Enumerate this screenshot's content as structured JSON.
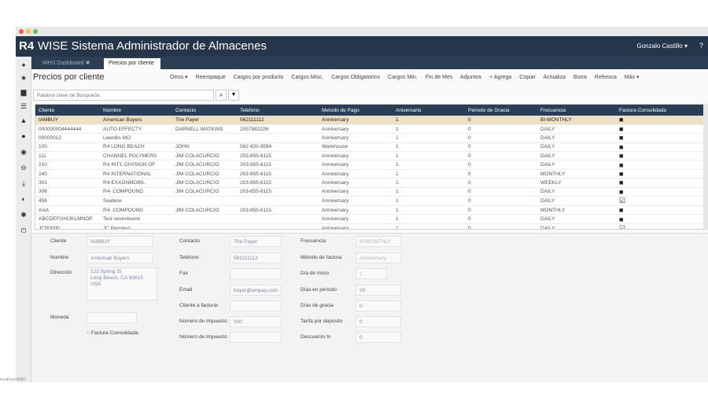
{
  "app": {
    "logo": "R4",
    "title": "WISE Sistema Administrador de Almacenes",
    "user": "Gonzalo Castillo ▾",
    "help": "?"
  },
  "tabs": [
    {
      "label": "WHS Dashboard ✖"
    },
    {
      "label": "Precios por cliente"
    }
  ],
  "page": {
    "title": "Precios por cliente"
  },
  "toolbar": {
    "items": [
      "Otros ▾",
      "Reempaque",
      "Cargos por producto",
      "Cargos Misc.",
      "Cargos Obligatorios",
      "Cargos Min.",
      "Fin de Mes",
      "Adjuntos",
      "+ Agrega",
      "Copiar",
      "Actualiza",
      "Borra",
      "Refresca",
      "Más ▾"
    ]
  },
  "search": {
    "placeholder": "Palabra clave de Busqueda"
  },
  "grid": {
    "columns": [
      "Cliente",
      "Nombre",
      "Contacto",
      "Telefono",
      "Metodo de Pago",
      "Aniversario",
      "Periodo de Gracia",
      "Frecuencia",
      "Factura Consolidada"
    ],
    "rows": [
      [
        "IAMBUY",
        "American Buyers",
        "The Payer",
        "562111112",
        "Anniversary",
        "1",
        "0",
        "BI-MONTHLY",
        "■"
      ],
      [
        "000000004444444",
        "AUTO EFFECTY",
        "DARNELL WATKINS",
        "2057882226",
        "Anniversary",
        "1",
        "0",
        "DAILY",
        "■"
      ],
      [
        "00000012",
        "Leenibs MO",
        "",
        "",
        "Anniversary",
        "1",
        "0",
        "DAILY",
        "■"
      ],
      [
        "100",
        "R4 LONG BEACH",
        "JOHN",
        "562 420-9594",
        "Warehouse",
        "1",
        "0",
        "DAILY",
        "■"
      ],
      [
        "111",
        "CHANNEL POLYMERS",
        "JIM COLACURCIO",
        "203-855-6115",
        "Anniversary",
        "1",
        "0",
        "DAILY",
        "■"
      ],
      [
        "210",
        "R4 INT'L DIVISION OF",
        "JIM COLACURCIO",
        "203-855-6115",
        "Anniversary",
        "1",
        "0",
        "DAILY",
        "■"
      ],
      [
        "240",
        "R4 INTERNATIONAL",
        "JIM COLACURCIO",
        "203-855-6115",
        "Anniversary",
        "1",
        "0",
        "MONTHLY",
        "■"
      ],
      [
        "301",
        "R4-EXXONMOBIL",
        "JIM COLACURCIO",
        "203-855-6115",
        "Anniversary",
        "1",
        "0",
        "WEEKLY",
        "■"
      ],
      [
        "306",
        "R4- COMPOUND",
        "JIM COLACURCIO",
        "203-855-6115",
        "Anniversary",
        "1",
        "0",
        "DAILY",
        "■"
      ],
      [
        "456",
        "Sealane",
        "",
        "",
        "Anniversary",
        "1",
        "0",
        "DAILY",
        "☑"
      ],
      [
        "AAA",
        "R4- COMPOUND",
        "JIM COLACURCIO",
        "203-855-6115",
        "Anniversary",
        "1",
        "0",
        "MONTHLY",
        "■"
      ],
      [
        "ABCDEFGHIJKLMNOP",
        "Test seventeenn",
        "",
        "",
        "Anniversary",
        "1",
        "0",
        "DAILY",
        "■"
      ],
      [
        "JCP0000",
        "JC Penneys",
        "",
        "",
        "Anniversary",
        "1",
        "0",
        "DAILY",
        "☑"
      ]
    ]
  },
  "detail": {
    "cliente_label": "Cliente",
    "cliente": "IAMBUY",
    "nombre_label": "Nombre",
    "nombre": "American Buyers",
    "direccion_label": "Dirección",
    "direccion": "123 Spring St.\nLong Beach, CA 90815\nUSA",
    "moneda_label": "Moneda",
    "factura_consolidada": "Factura Consolidada",
    "contacto_label": "Contacto",
    "contacto": "The Payer",
    "telefono_label": "Teléfono",
    "telefono": "562111112",
    "fax_label": "Fax",
    "email_label": "Email",
    "email": "buyer@ampay.com",
    "cliente_facturar_label": "Cliente a facturar",
    "num_impuesto_label": "Número de Impuesto",
    "num_impuesto": "000",
    "num_impuesto2_label": "Número de Impuesto",
    "frecuencia_label": "Frecuencia",
    "frecuencia": "BI-MONTHLY",
    "metodo_factura_label": "Método de factura",
    "metodo_factura": "Anniversary",
    "dia_inicio_label": "Día de Inicio",
    "dia_inicio": "1",
    "dias_periodo_label": "Días en periodo",
    "dias_periodo": "30",
    "dias_gracia_label": "Días de gracia",
    "dias_gracia": "0",
    "tarifa_deposito_label": "Tarifa por deposito",
    "tarifa_deposito": "0",
    "descuento_label": "Descuento %",
    "descuento": "0"
  },
  "status": {
    "text": "localhost:8080"
  },
  "colors": {
    "header": "#25354a",
    "grid_header": "#2a3f57",
    "selected_row": "#efe0c4",
    "value_text": "#7c87a8"
  }
}
